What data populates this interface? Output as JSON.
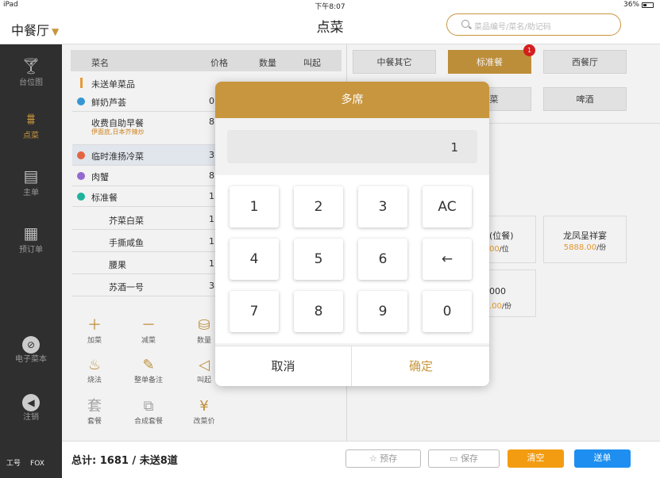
{
  "status": {
    "device": "iPad",
    "time": "下午8:07",
    "battery": "36%",
    "battery_level": 0.36
  },
  "nav": {
    "hall": "中餐厅",
    "title": "点菜",
    "search_placeholder": "菜品编号/菜名/助记码"
  },
  "sidebar": [
    {
      "label": "台位图",
      "icon": "table-icon"
    },
    {
      "label": "点菜",
      "icon": "dish-icon",
      "active": true
    },
    {
      "label": "主单",
      "icon": "clipboard-icon"
    },
    {
      "label": "预订单",
      "icon": "document-icon"
    },
    {
      "label": "电子菜本",
      "icon": "electronic-menu-icon"
    },
    {
      "label": "注销",
      "icon": "logout-icon"
    }
  ],
  "footer": {
    "staff_label": "工号",
    "staff_id": "FOX"
  },
  "order_table": {
    "headers": [
      "菜名",
      "价格",
      "数量",
      "叫起"
    ],
    "unsent_label": "未送单菜品",
    "rows": [
      {
        "name": "鲜奶芦荟",
        "price": "0"
      },
      {
        "name": "收费自助早餐",
        "price": "8",
        "note": "伊面底,日本芥辣炒"
      },
      {
        "name": "临时淮扬冷菜",
        "price": "3"
      },
      {
        "name": "肉蟹",
        "price": "8"
      },
      {
        "name": "标准餐",
        "price": "15"
      },
      {
        "name": "芥菜白菜",
        "price": "1"
      },
      {
        "name": "手撕咸鱼",
        "price": "1"
      },
      {
        "name": "腰果",
        "price": "1"
      },
      {
        "name": "苏酒一号",
        "price": "38"
      }
    ]
  },
  "toolbar": {
    "add": "加菜",
    "reduce": "减菜",
    "quantity": "数量",
    "cooking": "烧法",
    "order_note": "整单备注",
    "call": "叫起",
    "set_meal": "套餐",
    "combine_set": "合成套餐",
    "change_price": "改菜价",
    "set_glyph": "套",
    "yuan_glyph": "¥"
  },
  "categories": [
    {
      "label": "中餐其它"
    },
    {
      "label": "标准餐",
      "active": true,
      "badge": "1"
    },
    {
      "label": "西餐厅"
    },
    {
      "label": "热菜"
    },
    {
      "label": "啤酒"
    }
  ],
  "dishes": [
    {
      "name": "(位餐)",
      "price": "00",
      "unit": "/位"
    },
    {
      "name": "龙凤呈祥宴",
      "price": "5888.00",
      "unit": "/份"
    },
    {
      "name": "000",
      "price": ".00",
      "unit": "/份"
    }
  ],
  "bottom": {
    "total": "总计: 1681 / 未送8道",
    "hold": "预存",
    "save": "保存",
    "clear": "清空",
    "send": "送单"
  },
  "dialog": {
    "title": "多席",
    "value": "1",
    "keys": [
      "1",
      "2",
      "3",
      "AC",
      "4",
      "5",
      "6",
      "←",
      "7",
      "8",
      "9",
      "0"
    ],
    "cancel": "取消",
    "confirm": "确定"
  }
}
